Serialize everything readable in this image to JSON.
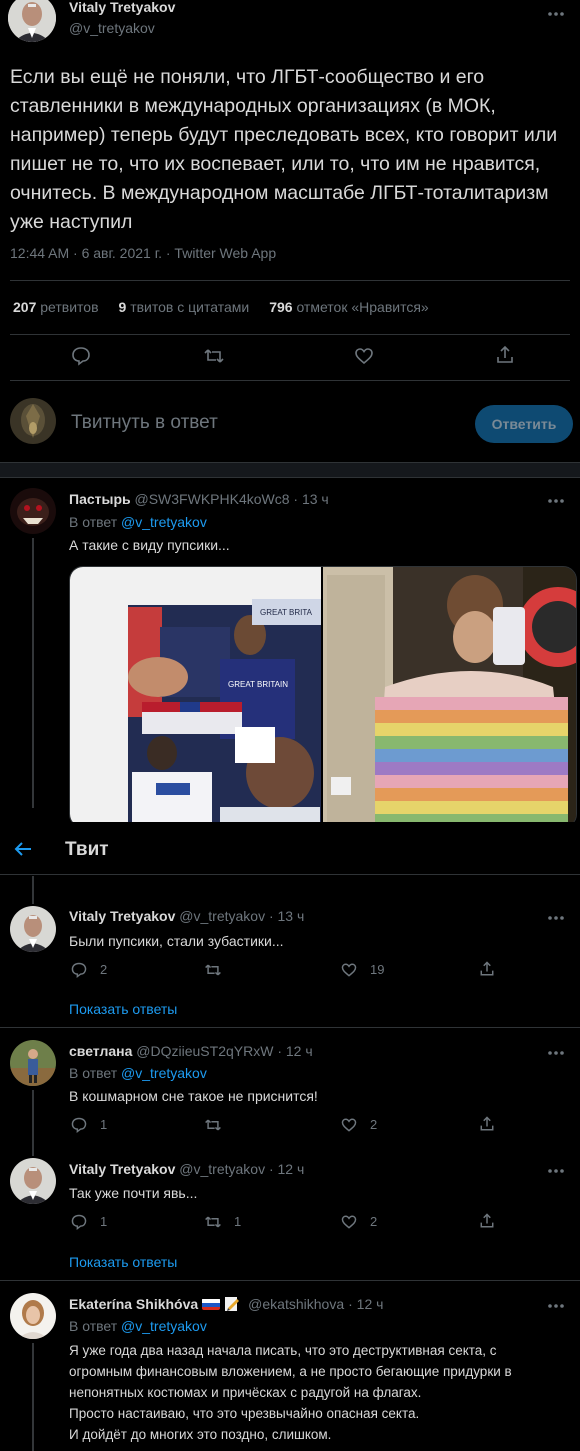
{
  "main_tweet": {
    "author_name": "Vitaly Tretyakov",
    "author_handle": "@v_tretyakov",
    "text": "Если вы ещё не поняли, что ЛГБТ-сообщество и его ставленники в международных организациях (в МОК, например) теперь будут преследовать всех, кто говорит или пишет не то, что их воспевает, или то, что им не нравится, очнитесь. В международном масштабе ЛГБТ-тоталитаризм уже наступил",
    "meta": "12:44 AM · 6 авг. 2021 г. · Twitter Web App",
    "retweets_count": "207",
    "retweets_label": "ретвитов",
    "quotes_count": "9",
    "quotes_label": "твитов с цитатами",
    "likes_count": "796",
    "likes_label": "отметок «Нравится»"
  },
  "composer": {
    "placeholder": "Твитнуть в ответ",
    "reply_button": "Ответить"
  },
  "header": {
    "title": "Твит"
  },
  "replies": [
    {
      "name": "Пастырь",
      "handle": "@SW3FWKPHK4koWc8",
      "time": "· 13 ч",
      "reply_to_prefix": "В ответ",
      "reply_to": "@v_tretyakov",
      "text": "А такие с виду пупсики..."
    },
    {
      "name": "Vitaly Tretyakov",
      "handle": "@v_tretyakov",
      "time": "· 13 ч",
      "text": "Были пупсики, стали зубастики...",
      "replies": "2",
      "retweets": "",
      "likes": "19",
      "show_replies": "Показать ответы"
    },
    {
      "name": "светлана",
      "handle": "@DQziieuST2qYRxW",
      "time": "· 12 ч",
      "reply_to_prefix": "В ответ",
      "reply_to": "@v_tretyakov",
      "text": "В кошмарном сне такое не приснится!",
      "replies": "1",
      "retweets": "",
      "likes": "2"
    },
    {
      "name": "Vitaly Tretyakov",
      "handle": "@v_tretyakov",
      "time": "· 12 ч",
      "text": "Так уже почти явь...",
      "replies": "1",
      "retweets": "1",
      "likes": "2",
      "show_replies": "Показать ответы"
    },
    {
      "name": "Ekaterína Shikhóva",
      "handle": "@ekatshikhova",
      "time": "· 12 ч",
      "reply_to_prefix": "В ответ",
      "reply_to": "@v_tretyakov",
      "text_lines": [
        "Я уже года два назад начала писать, что это деструктивная секта, с",
        "огромным финансовым вложением, а не просто бегающие придурки в",
        "непонятных костюмах и причёсках с радугой на флагах.",
        "Просто настаиваю, что это чрезвычайно опасная секта.",
        "И дойдёт до многих это поздно, слишком."
      ]
    }
  ],
  "photo": {
    "jersey_text_1": "GREAT BRITAIN",
    "jersey_text_2": "GREAT BRITA",
    "jersey_text_3": "GREAT BRITAIN"
  },
  "colors": {
    "accent": "#1d9bf0",
    "muted": "#6e767d",
    "separator": "#2f3336",
    "reply_button_bg": "#0e4a72"
  }
}
